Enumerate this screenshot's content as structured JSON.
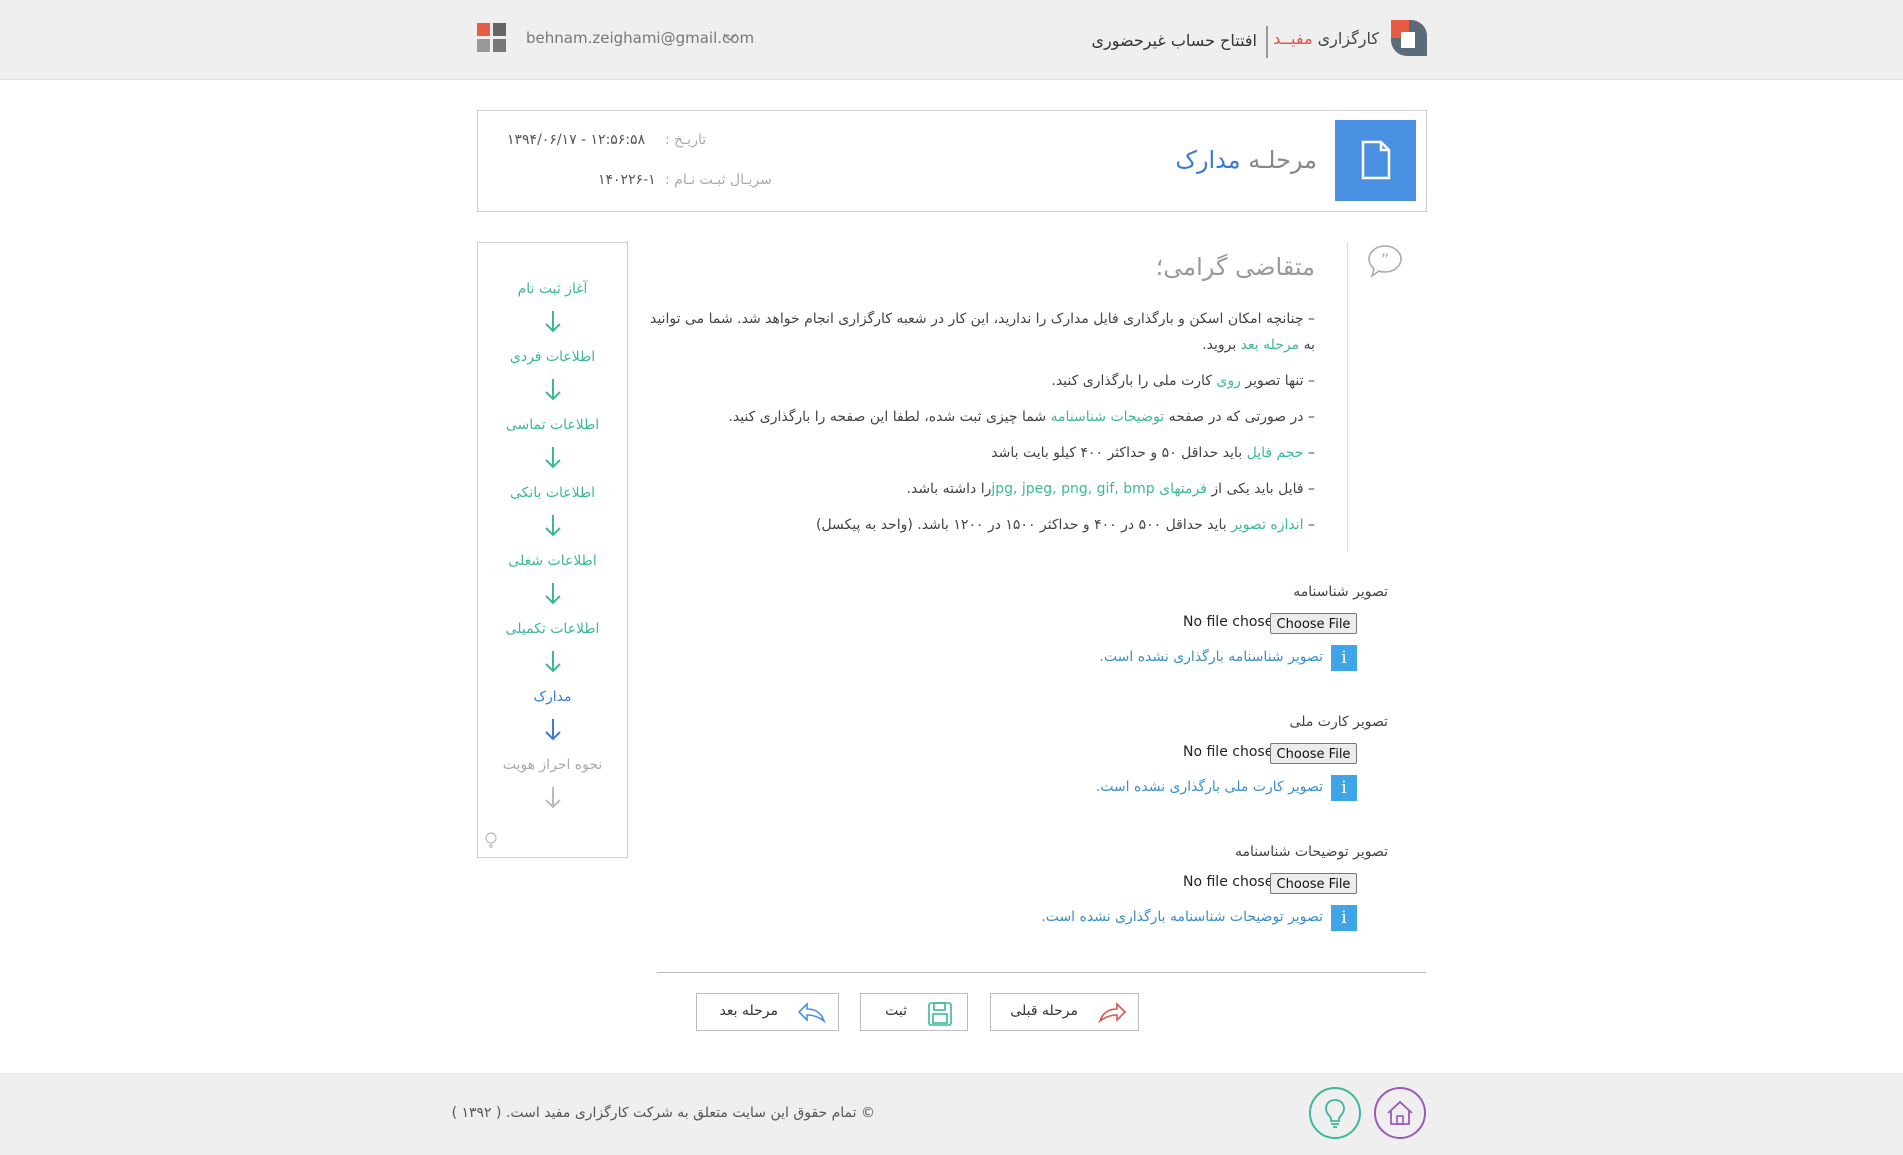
{
  "header": {
    "brand_prefix": "کارگزاری ",
    "brand_accent": "مفیــد",
    "open_account": "افتتاح حساب غیرحضوری",
    "email": "behnam.zeighami@gmail.com"
  },
  "stage": {
    "title_prefix": "مرحلـه ",
    "title_name": "مدارک",
    "date_label": "تاریـخ :",
    "date_value": "۱۳۹۴/۰۶/۱۷ - ۱۲:۵۶:۵۸",
    "serial_label": "سریـال ثبـت نـام :",
    "serial_value": "۱۴۰۲۲۶-۱"
  },
  "steps": [
    {
      "label": "آغاز ثبت نام",
      "state": "done"
    },
    {
      "label": "اطلاعات فردی",
      "state": "done"
    },
    {
      "label": "اطلاعات تماسی",
      "state": "done"
    },
    {
      "label": "اطلاعات بانکی",
      "state": "done"
    },
    {
      "label": "اطلاعات شغلی",
      "state": "done"
    },
    {
      "label": "اطلاعات تکمیلی",
      "state": "done"
    },
    {
      "label": "مدارک",
      "state": "active"
    },
    {
      "label": "نحوه احراز هویت",
      "state": "pending"
    }
  ],
  "notice": {
    "title": "متقاضی گرامی؛",
    "line1_a": "– چنانچه امکان اسکن و بارگذاری فایل مدارک را ندارید، این کار در شعبه کارگزاری انجام خواهد شد. شما می توانید به ",
    "line1_link": "مرحله بعد",
    "line1_b": " بروید.",
    "line2_a": "– تنها تصویر ",
    "line2_g": "روی",
    "line2_b": " کارت ملی را بارگذاری کنید.",
    "line3_a": "– در صورتی که در صفحه ",
    "line3_g": "توضیحات شناسنامه",
    "line3_b": " شما چیزی ثبت شده، لطفا این صفحه را بارگذاری کنید.",
    "line4_a": "– ",
    "line4_g": "حجم فایل",
    "line4_b": " باید حداقل ۵۰ و حداکثر ۴۰۰ کیلو بایت باشد",
    "line5_a": "– فایل باید یکی از ",
    "line5_g": "فرمتهای jpg, jpeg, png, gif, bmp",
    "line5_b": "را داشته باشد.",
    "line6_a": "– ",
    "line6_g": "اندازه تصویر",
    "line6_b": " باید حداقل ۵۰۰ در ۴۰۰ و حداکثر ۱۵۰۰ در ۱۲۰۰ باشد. (واحد به پیکسل)"
  },
  "uploads": [
    {
      "label": "تصویر شناسنامه",
      "no_file": "No file chosen",
      "button": "Choose File",
      "message": "تصویر شناسنامه بارگذاری نشده است."
    },
    {
      "label": "تصویر کارت ملی",
      "no_file": "No file chosen",
      "button": "Choose File",
      "message": "تصویر کارت ملی بارگذاری نشده است."
    },
    {
      "label": "تصویر توضیحات شناسنامه",
      "no_file": "No file chosen",
      "button": "Choose File",
      "message": "تصویر توضیحات شناسنامه بارگذاری نشده است."
    }
  ],
  "info_glyph": "i",
  "nav": {
    "prev": "مرحله قبلی",
    "save": "ثبت",
    "next": "مرحله بعد"
  },
  "footer": {
    "copyright": "© تمام حقوق این سایت متعلق به شرکت کارگزاری مفید است. ( ۱۳۹۲ )"
  },
  "colors": {
    "accent_green": "#3db89a",
    "accent_blue": "#4a90e2",
    "brand_red": "#e0524a",
    "info_blue": "#3ea6e8"
  }
}
